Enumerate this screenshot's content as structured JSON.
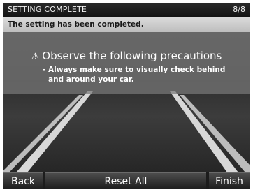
{
  "header": {
    "title": "SETTING COMPLETE",
    "page_indicator": "8/8"
  },
  "status_message": "The setting has been completed.",
  "precaution": {
    "icon": "warning-icon",
    "title": "Observe the following precautions",
    "detail_line1": "- Always make sure to visually check behind",
    "detail_line2": "and around your car."
  },
  "buttons": {
    "back": "Back",
    "reset_all": "Reset All",
    "finish": "Finish"
  }
}
